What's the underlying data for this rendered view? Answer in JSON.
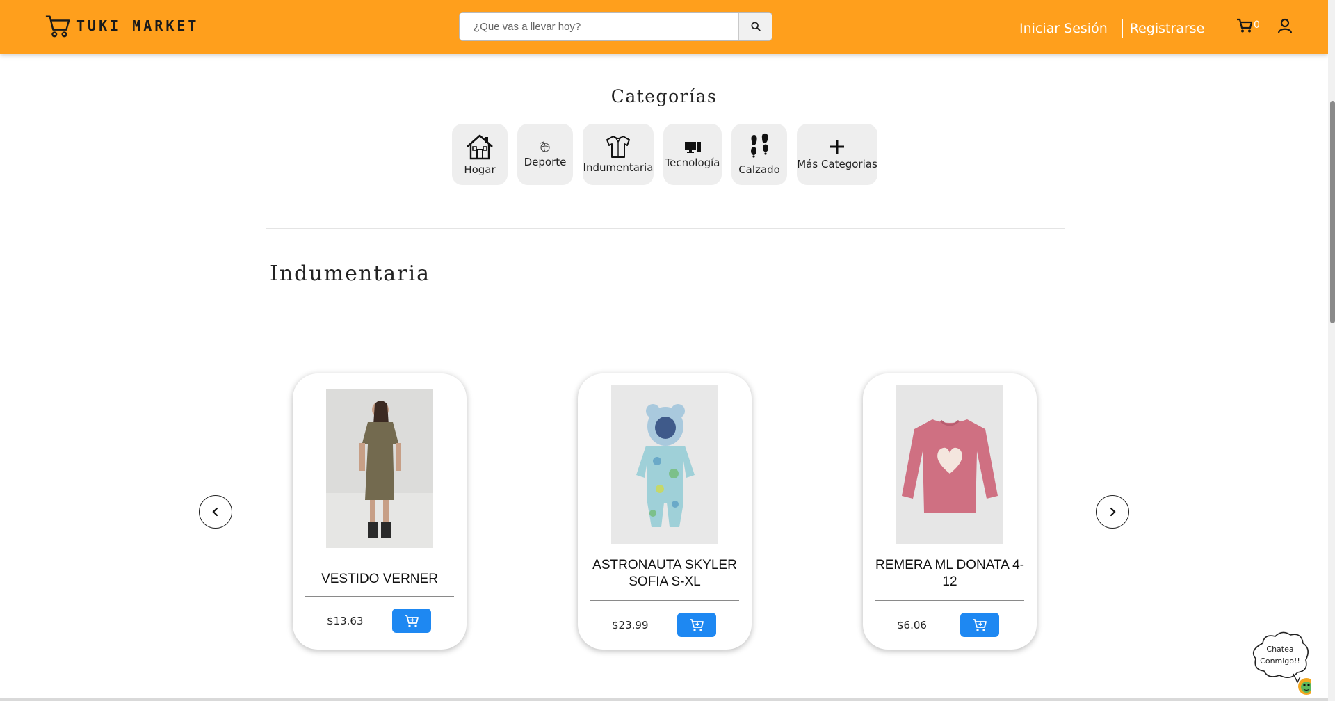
{
  "header": {
    "brand": "TUKI MARKET",
    "search_placeholder": "¿Que vas a llevar hoy?",
    "login_label": "Iniciar Sesión",
    "register_label": "Registrarse",
    "cart_count": "0"
  },
  "categories": {
    "title": "Categorías",
    "items": [
      {
        "label": "Hogar",
        "icon": "house-icon"
      },
      {
        "label": "Deporte",
        "icon": "sport-icon"
      },
      {
        "label": "Indumentaria",
        "icon": "shirt-icon"
      },
      {
        "label": "Tecnología",
        "icon": "computer-icon"
      },
      {
        "label": "Calzado",
        "icon": "footprints-icon"
      },
      {
        "label": "Más Categorias",
        "icon": "plus-icon"
      }
    ]
  },
  "section": {
    "title": "Indumentaria",
    "products": [
      {
        "name": "VESTIDO VERNER",
        "price": "$13.63",
        "image": "olive-dress-photo"
      },
      {
        "name": "ASTRONAUTA SKYLER SOFIA S-XL",
        "price": "$23.99",
        "image": "baby-snowsuit-photo"
      },
      {
        "name": "REMERA ML DONATA 4-12",
        "price": "$6.06",
        "image": "pink-longsleeve-photo"
      }
    ]
  },
  "chat": {
    "line1": "Chatea",
    "line2": "Conmigo!!"
  },
  "colors": {
    "header": "#FF9F1C",
    "add_button": "#1E88F2",
    "category_bg": "#EEEEEE"
  }
}
